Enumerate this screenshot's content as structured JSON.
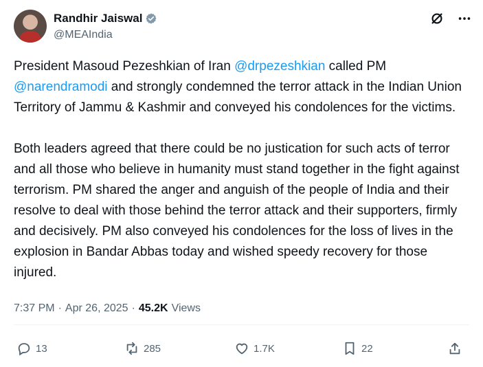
{
  "user": {
    "display_name": "Randhir Jaiswal",
    "handle": "@MEAIndia",
    "verified_icon": "verified-badge-icon"
  },
  "top_actions": {
    "left_icon": "grok-icon",
    "right_icon": "more-icon"
  },
  "tweet": {
    "p1_prefix": "President Masoud Pezeshkian of Iran ",
    "mention_1": "@drpezeshkian",
    "p1_middle": " called PM ",
    "mention_2": "@narendramodi",
    "p1_suffix": " and strongly condemned the terror attack in the Indian Union Territory of Jammu & Kashmir and conveyed his condolences for the victims.",
    "p2": "Both leaders agreed that there could be no justication for such acts of terror and all those who believe in humanity must stand together in the fight against terrorism. PM shared the anger and anguish of the people of India and their resolve to deal with those behind the terror attack and their supporters, firmly and decisively. PM also conveyed his condolences for the loss of lives in the explosion in Bandar Abbas today and wished speedy recovery for those injured."
  },
  "meta": {
    "time": "7:37 PM",
    "separator_1": "·",
    "date": "Apr 26, 2025",
    "separator_2": "·",
    "views_count": "45.2K",
    "views_label": "Views"
  },
  "actions": {
    "reply_count": "13",
    "repost_count": "285",
    "like_count": "1.7K",
    "bookmark_count": "22"
  },
  "colors": {
    "text": "#0f1419",
    "muted": "#536471",
    "mention": "#1d9bf0",
    "verified": "#829aab"
  }
}
